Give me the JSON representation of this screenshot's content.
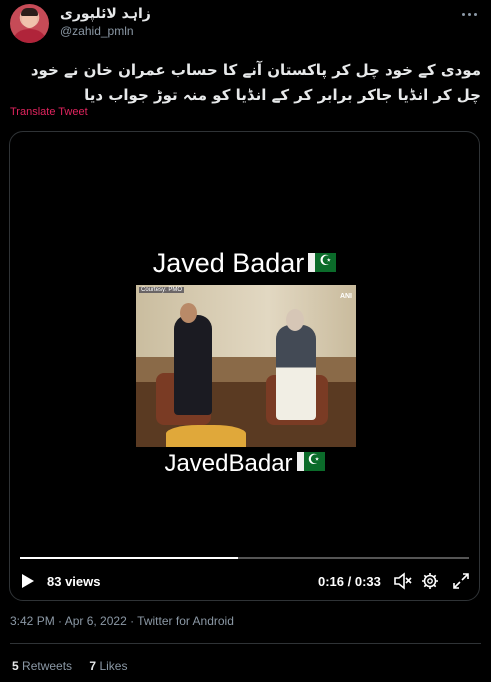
{
  "author": {
    "display_name": "زاہد لائلپوری",
    "handle": "@zahid_pmln"
  },
  "tweet": {
    "text": "مودی کے خود چل کر پاکستان آنے کا حساب عمران خان نے خود چل کر انڈیا جاکر برابر کر کے انڈیا کو منہ توڑ جواب دیا",
    "translate_label": "Translate Tweet"
  },
  "video": {
    "overlay_top": "Javed Badar",
    "overlay_bottom": "JavedBadar",
    "frame_credit": "Courtesy: PMO",
    "frame_logo": "ANI",
    "views": "83 views",
    "time": "0:16 / 0:33",
    "progress_fraction": 0.485
  },
  "meta": {
    "timestamp": "3:42 PM · Apr 6, 2022 · Twitter for Android"
  },
  "stats": {
    "retweets_count": "5",
    "retweets_label": "Retweets",
    "likes_count": "7",
    "likes_label": "Likes"
  },
  "colors": {
    "background": "#000000",
    "link_pink": "#e0245e",
    "muted": "#8b98a5"
  }
}
